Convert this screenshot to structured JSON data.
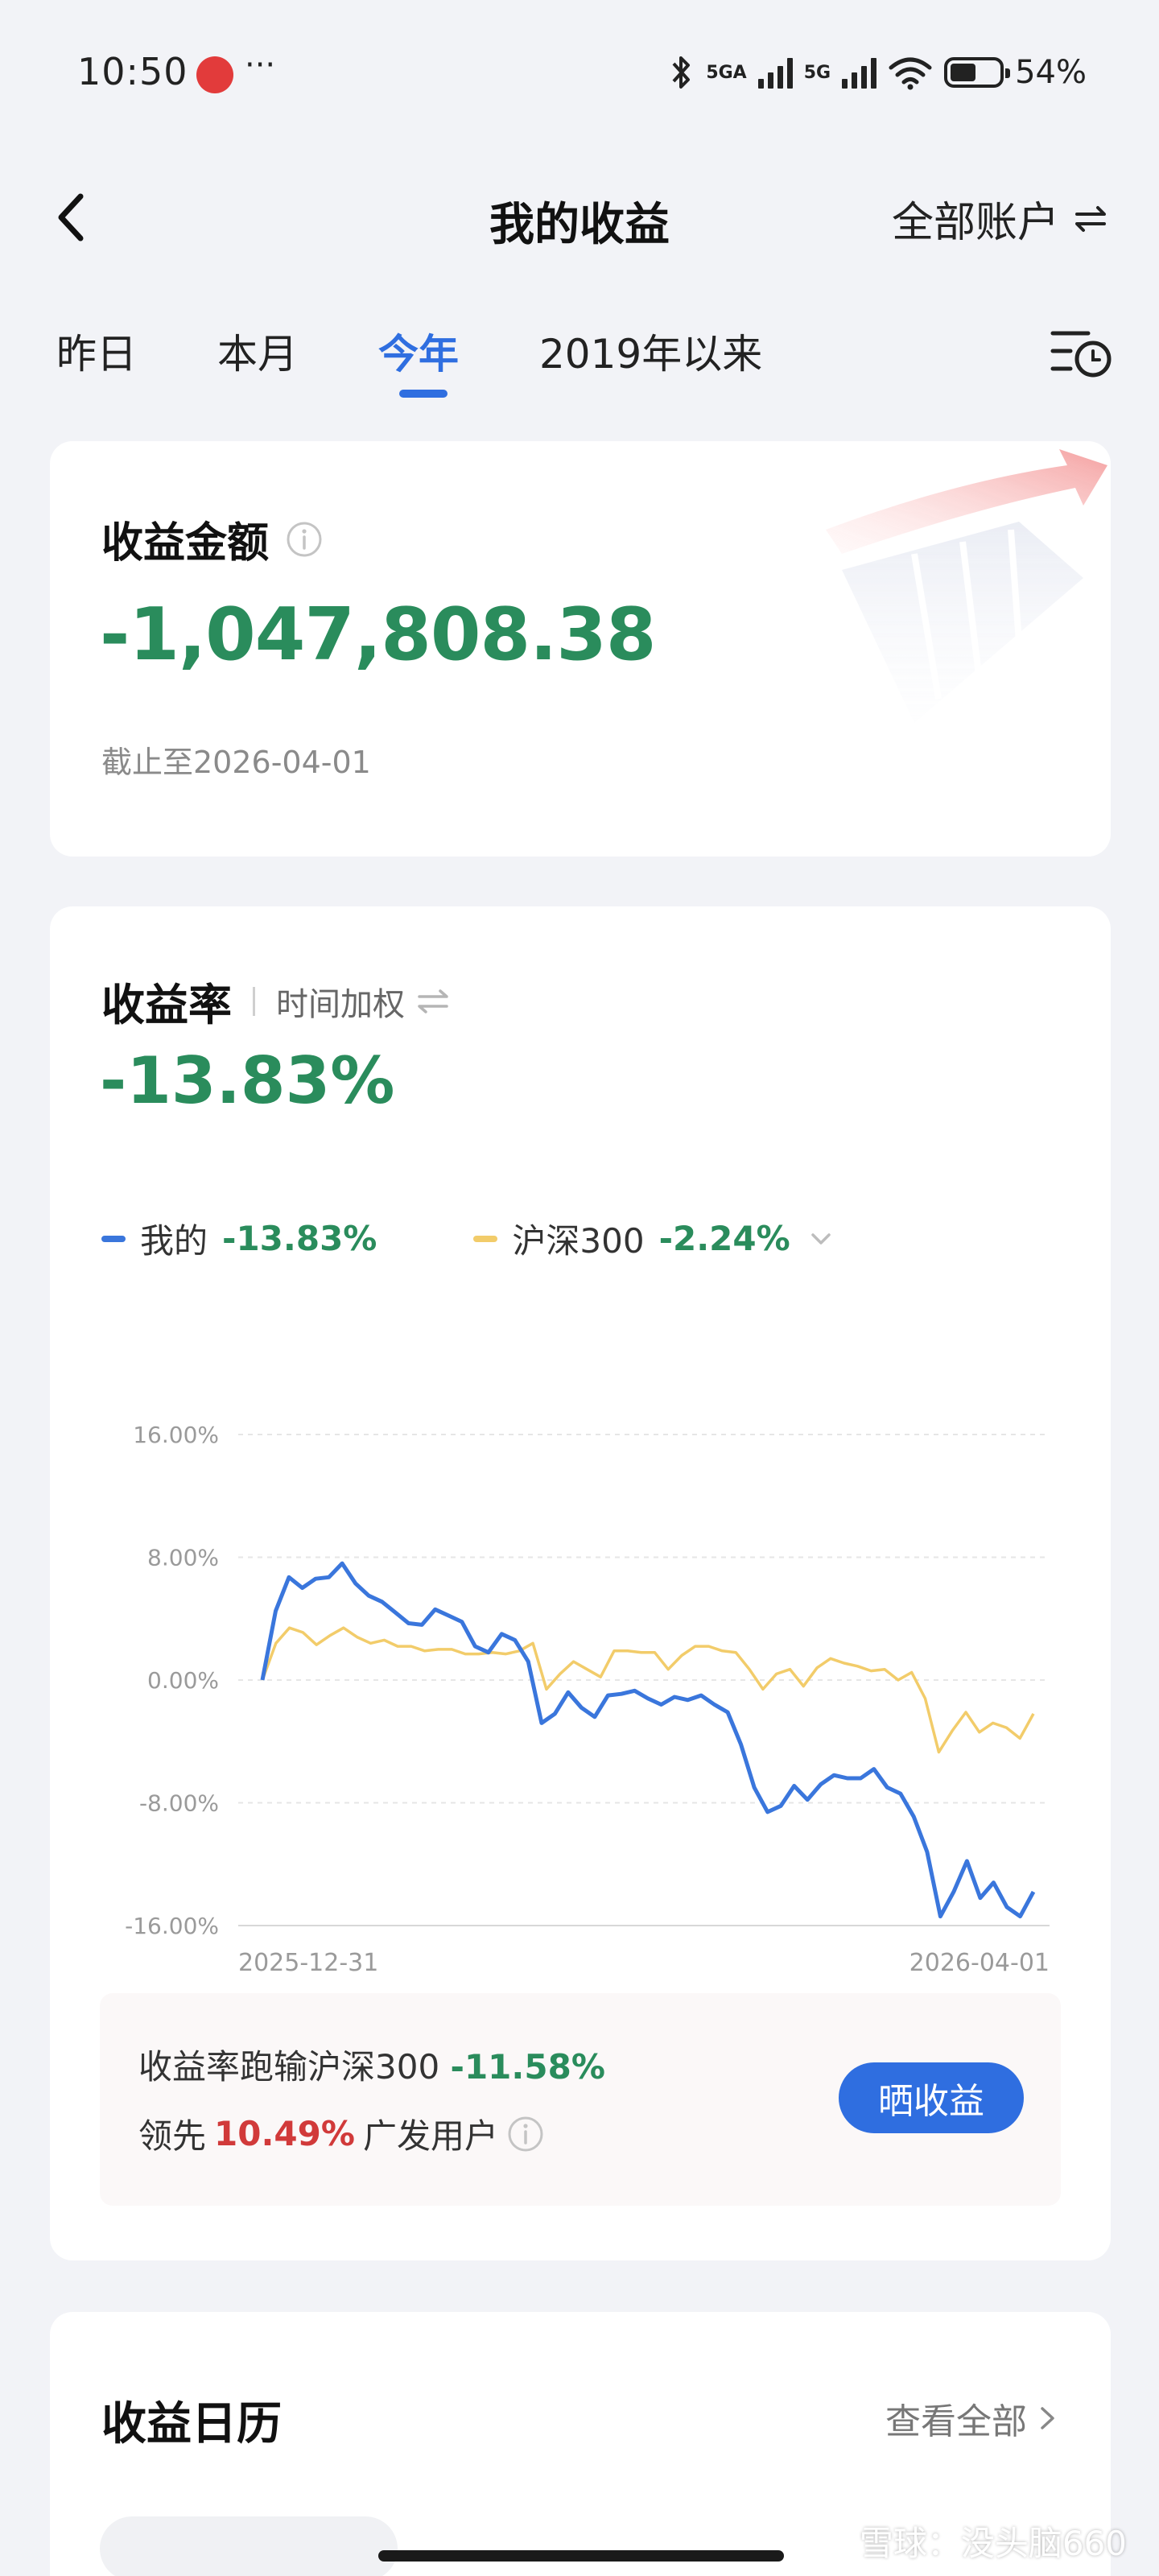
{
  "status_bar": {
    "time": "10:50",
    "dots": "···",
    "network1": "5GA",
    "network2": "5G",
    "battery_text": "54%",
    "battery_level": 0.54
  },
  "header": {
    "title": "我的收益",
    "account": "全部账户"
  },
  "tabs": [
    {
      "label": "昨日",
      "active": false
    },
    {
      "label": "本月",
      "active": false
    },
    {
      "label": "今年",
      "active": true
    },
    {
      "label": "2019年以来",
      "active": false
    }
  ],
  "amount_card": {
    "title": "收益金额",
    "value": "-1,047,808.38",
    "date_text": "截止至2026-04-01"
  },
  "rate_card": {
    "title": "收益率",
    "weight_label": "时间加权",
    "value": "-13.83%",
    "legend": [
      {
        "name": "我的",
        "value": "-13.83%",
        "color": "#3a76dc"
      },
      {
        "name": "沪深300",
        "value": "-2.24%",
        "color": "#f2cc6a"
      }
    ]
  },
  "chart_data": {
    "type": "line",
    "y_ticks": [
      "16.00%",
      "8.00%",
      "0.00%",
      "-8.00%",
      "-16.00%"
    ],
    "ylim": [
      -16,
      16
    ],
    "x_labels": [
      "2025-12-31",
      "2026-04-01"
    ],
    "grid": true,
    "series": [
      {
        "name": "我的",
        "color": "#3a76dc",
        "values": [
          0,
          4.5,
          6.7,
          6.0,
          6.6,
          6.7,
          7.6,
          6.3,
          5.5,
          5.1,
          4.4,
          3.7,
          3.6,
          4.6,
          4.2,
          3.8,
          2.2,
          1.8,
          3.0,
          2.6,
          1.2,
          -2.8,
          -2.2,
          -0.8,
          -1.8,
          -2.4,
          -1.0,
          -0.9,
          -0.7,
          -1.2,
          -1.6,
          -1.1,
          -1.3,
          -1.0,
          -1.6,
          -2.1,
          -4.2,
          -7.0,
          -8.6,
          -8.2,
          -6.9,
          -7.8,
          -6.8,
          -6.2,
          -6.4,
          -6.4,
          -5.8,
          -7.0,
          -7.4,
          -8.9,
          -11.2,
          -15.4,
          -13.8,
          -11.8,
          -14.2,
          -13.2,
          -14.8,
          -15.4,
          -13.8
        ],
        "ylabel": ""
      },
      {
        "name": "沪深300",
        "color": "#f2cc6a",
        "values": [
          0,
          2.4,
          3.4,
          3.1,
          2.3,
          2.9,
          3.4,
          2.8,
          2.4,
          2.6,
          2.2,
          2.2,
          1.9,
          2.0,
          2.0,
          1.7,
          1.7,
          1.8,
          1.7,
          1.9,
          2.4,
          -0.6,
          0.4,
          1.2,
          0.7,
          0.2,
          1.9,
          1.9,
          1.8,
          1.8,
          0.7,
          1.6,
          2.2,
          2.2,
          1.9,
          1.8,
          0.7,
          -0.6,
          0.4,
          0.7,
          -0.4,
          0.8,
          1.4,
          1.1,
          0.9,
          0.6,
          0.7,
          0.0,
          0.5,
          -1.2,
          -4.7,
          -3.3,
          -2.1,
          -3.4,
          -2.8,
          -3.1,
          -3.8,
          -2.2
        ],
        "ylabel": ""
      }
    ],
    "title": "",
    "xlabel": ""
  },
  "compare": {
    "line1_text": "收益率跑输沪深300",
    "line1_value": "-11.58%",
    "line2_prefix": "领先",
    "line2_value": "10.49%",
    "line2_suffix": "广发用户",
    "share_label": "晒收益"
  },
  "calendar": {
    "title": "收益日历",
    "view_all": "查看全部"
  },
  "watermark": "雪球：没头脑660"
}
